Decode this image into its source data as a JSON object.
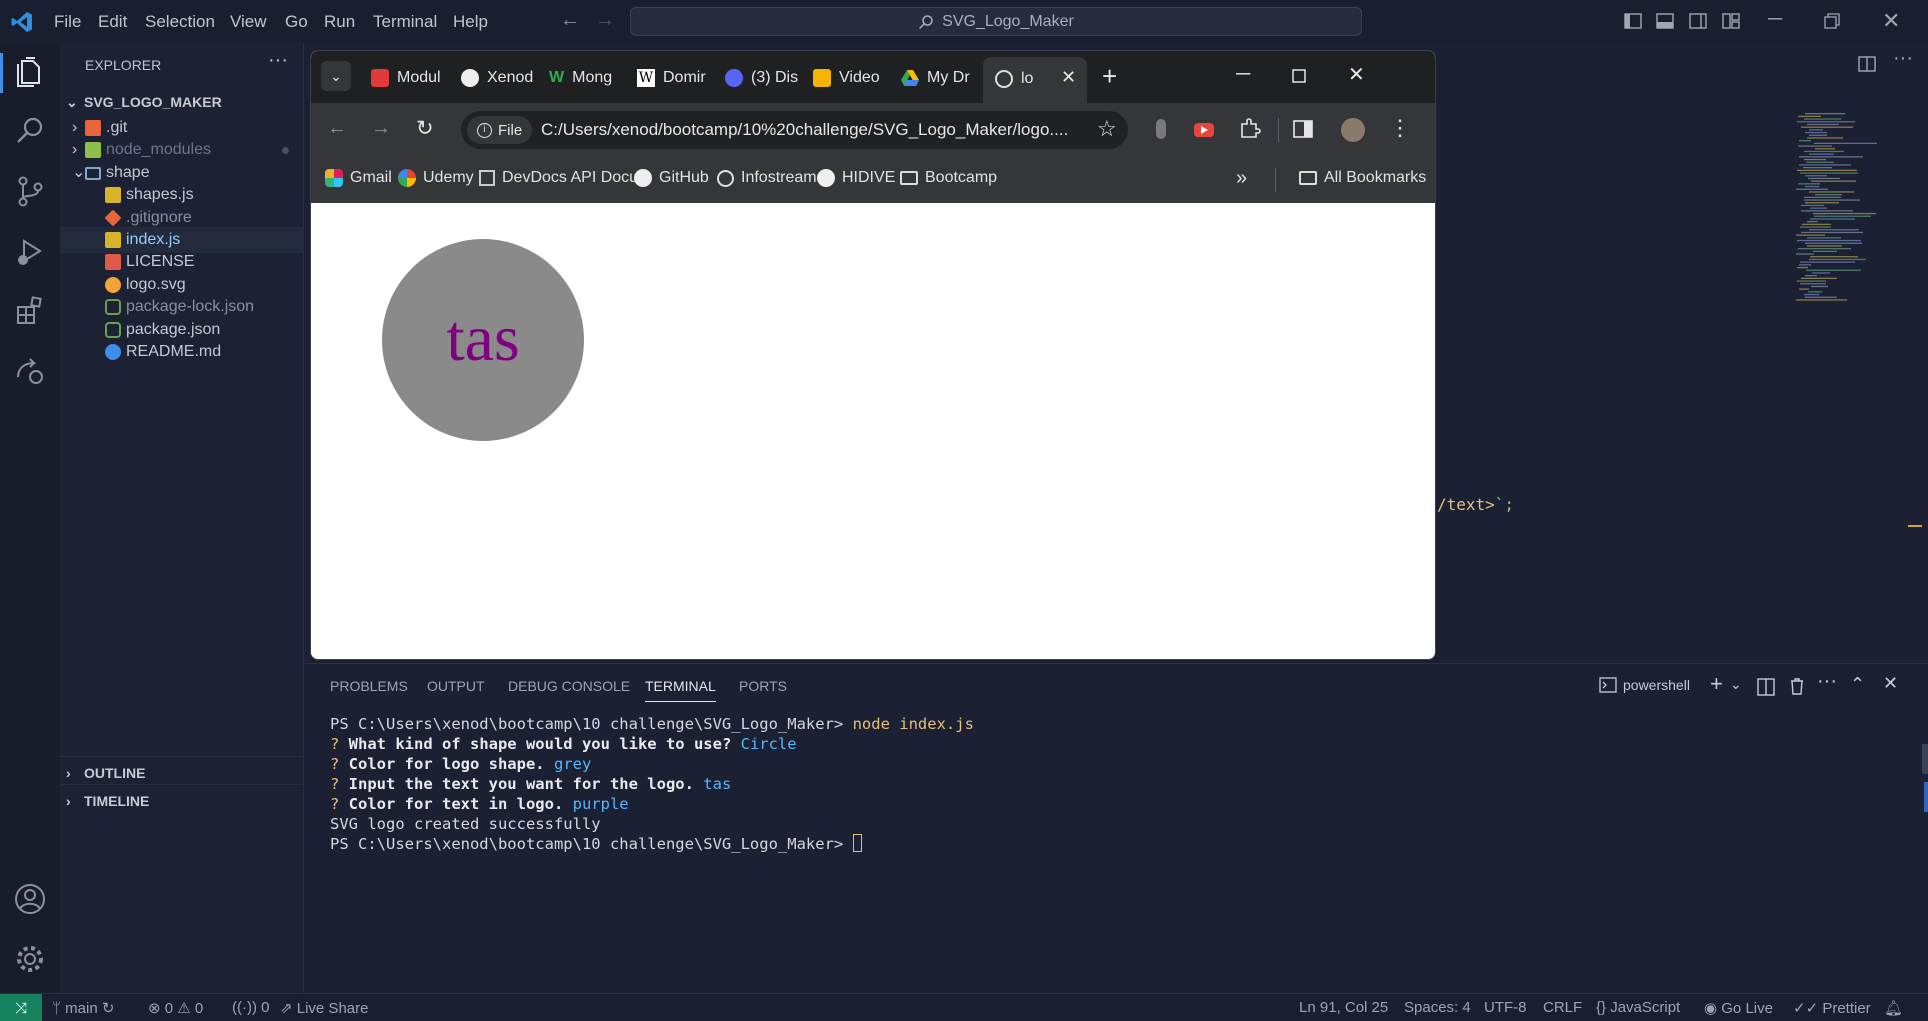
{
  "titlebar": {
    "menu": [
      "File",
      "Edit",
      "Selection",
      "View",
      "Go",
      "Run",
      "Terminal",
      "Help"
    ],
    "search_text": "SVG_Logo_Maker"
  },
  "sidebar": {
    "header": "EXPLORER",
    "project": "SVG_LOGO_MAKER",
    "items": [
      {
        "label": ".git",
        "color": "#c6c9d2"
      },
      {
        "label": "node_modules",
        "color": "#6f7689"
      },
      {
        "label": "shape",
        "color": "#c6c9d2"
      },
      {
        "label": "shapes.js",
        "color": "#c6c9d2"
      },
      {
        "label": ".gitignore",
        "color": "#8b8f9c"
      },
      {
        "label": "index.js",
        "color": "#8bd0ff"
      },
      {
        "label": "LICENSE",
        "color": "#c6c9d2"
      },
      {
        "label": "logo.svg",
        "color": "#c6c9d2"
      },
      {
        "label": "package-lock.json",
        "color": "#8b8f9c"
      },
      {
        "label": "package.json",
        "color": "#c6c9d2"
      },
      {
        "label": "README.md",
        "color": "#c6c9d2"
      }
    ],
    "outline": "OUTLINE",
    "timeline": "TIMELINE"
  },
  "browser": {
    "tabs": [
      "Modul",
      "Xenod",
      "Mong",
      "Domir",
      "(3) Dis",
      "Video",
      "My Dr",
      "lo"
    ],
    "address_chip": "File",
    "url": "C:/Users/xenod/bootcamp/10%20challenge/SVG_Logo_Maker/logo....",
    "bookmarks": [
      "Gmail",
      "Udemy",
      "DevDocs API Docu...",
      "GitHub",
      "Infostream",
      "HIDIVE",
      "Bootcamp"
    ],
    "all_bookmarks": "All Bookmarks",
    "overflow": "»",
    "logo": {
      "text": "tas",
      "shape": "circle",
      "shape_color": "#8a8a8a",
      "text_color": "#800080"
    }
  },
  "editor": {
    "code_fragment_a": "/text>",
    "code_fragment_b": "`;"
  },
  "panel": {
    "tabs": [
      "PROBLEMS",
      "OUTPUT",
      "DEBUG CONSOLE",
      "TERMINAL",
      "PORTS"
    ],
    "active_tab": "TERMINAL",
    "shell": "powershell",
    "lines": [
      {
        "prompt": "PS C:\\Users\\xenod\\bootcamp\\10 challenge\\SVG_Logo_Maker> ",
        "cmd": "node index.js"
      },
      {
        "q": "? ",
        "label": "What kind of shape would you like to use? ",
        "answer": "Circle"
      },
      {
        "q": "? ",
        "label": "Color for logo shape. ",
        "answer": "grey"
      },
      {
        "q": "? ",
        "label": "Input the text you want for the logo. ",
        "answer": "tas"
      },
      {
        "q": "? ",
        "label": "Color for text in logo. ",
        "answer": "purple"
      },
      {
        "plain": "SVG logo created successfully"
      },
      {
        "prompt": "PS C:\\Users\\xenod\\bootcamp\\10 challenge\\SVG_Logo_Maker> ",
        "cmd": ""
      }
    ]
  },
  "statusbar": {
    "branch": "main",
    "errors": "0",
    "warnings": "0",
    "ports": "0",
    "live_share": "Live Share",
    "position": "Ln 91, Col 25",
    "spaces": "Spaces: 4",
    "encoding": "UTF-8",
    "eol": "CRLF",
    "language": "JavaScript",
    "go_live": "Go Live",
    "prettier": "Prettier"
  }
}
